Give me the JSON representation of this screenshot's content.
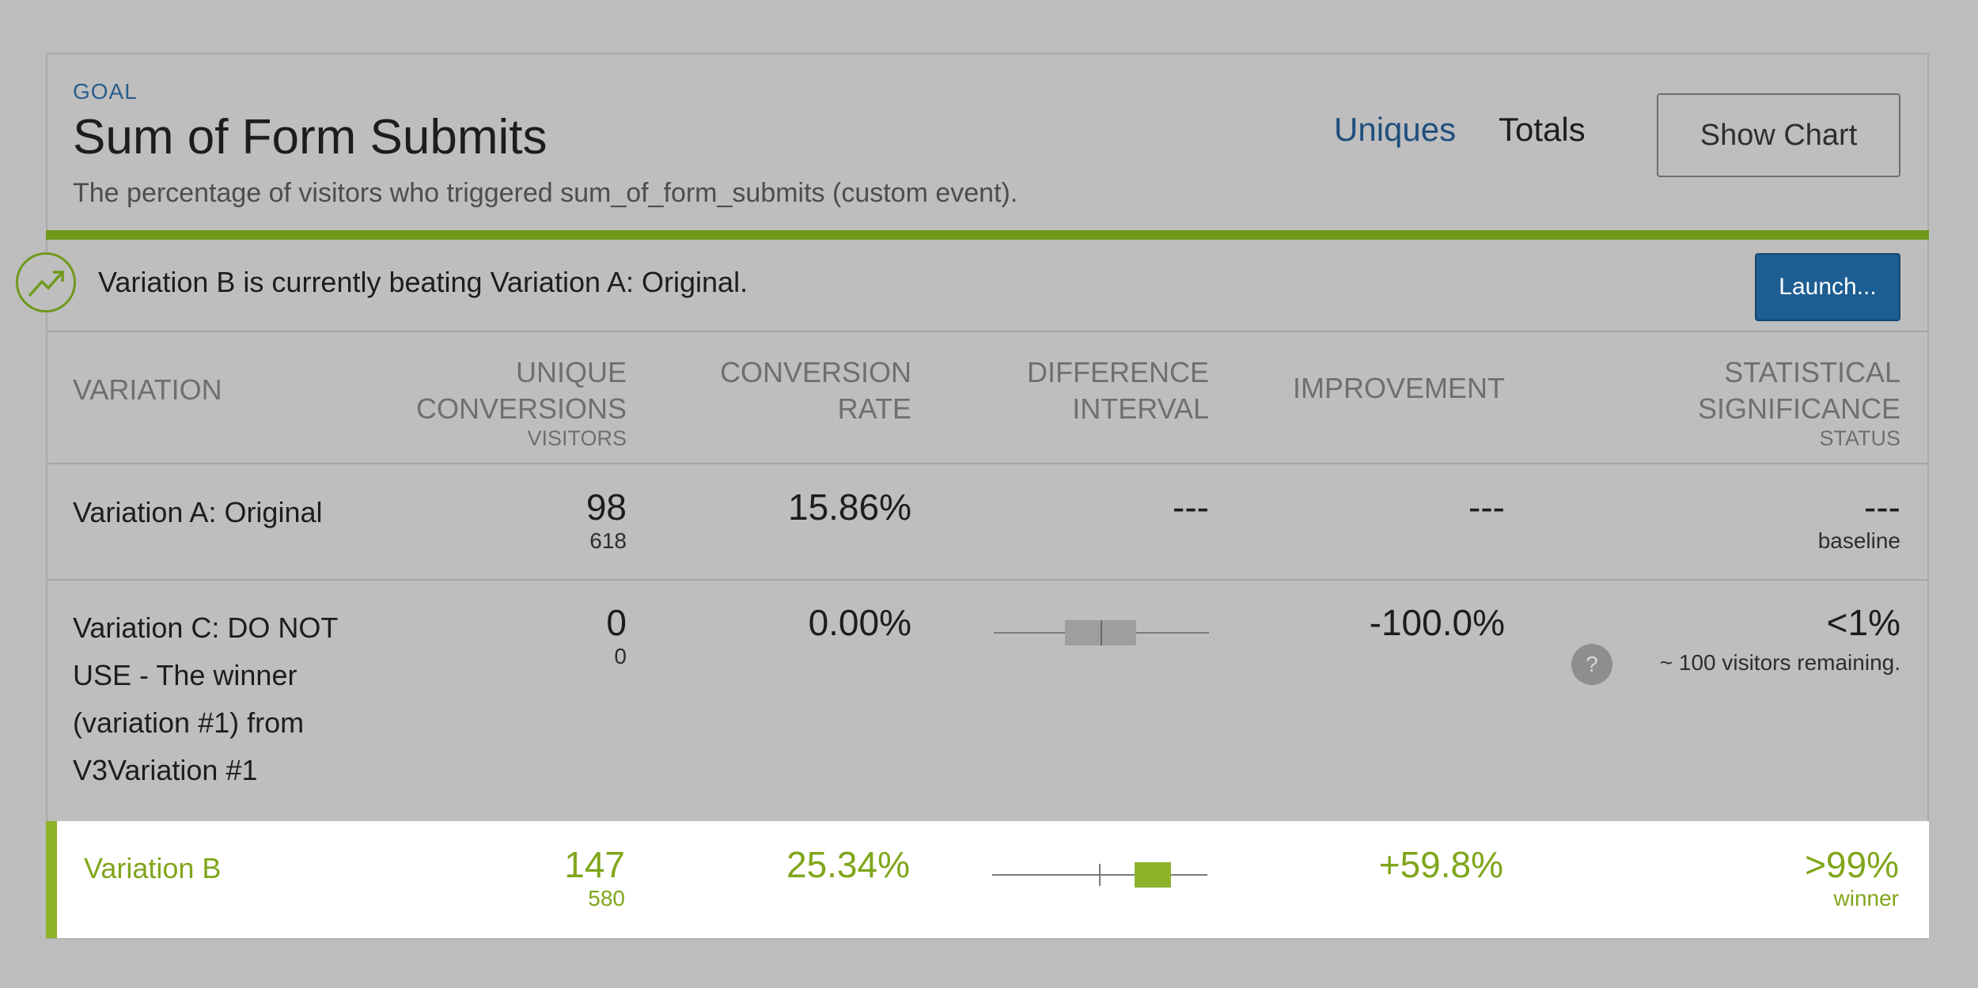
{
  "goal": {
    "label": "GOAL",
    "title": "Sum of Form Submits",
    "description": "The percentage of visitors who triggered sum_of_form_submits (custom event)."
  },
  "tabs": {
    "uniques": "Uniques",
    "totals": "Totals"
  },
  "show_chart_label": "Show Chart",
  "banner": {
    "icon": "trend-up-icon",
    "message": "Variation B is currently beating Variation A: Original.",
    "launch_label": "Launch..."
  },
  "columns": {
    "variation": "VARIATION",
    "unique_conversions": "UNIQUE CONVERSIONS",
    "visitors": "VISITORS",
    "conversion_rate": "CONVERSION RATE",
    "difference_interval": "DIFFERENCE INTERVAL",
    "improvement": "IMPROVEMENT",
    "statistical_significance": "STATISTICAL SIGNIFICANCE",
    "status": "STATUS"
  },
  "rows": [
    {
      "name": "Variation A: Original",
      "conversions": "98",
      "visitors": "618",
      "rate": "15.86%",
      "interval": "---",
      "improvement": "---",
      "significance": "---",
      "status": "baseline"
    },
    {
      "name_lines": [
        "Variation C: DO NOT",
        "USE - The winner",
        "(variation #1) from",
        "V3Variation #1"
      ],
      "conversions": "0",
      "visitors": "0",
      "rate": "0.00%",
      "interval_range": [
        -100,
        -50
      ],
      "improvement": "-100.0%",
      "significance": "<1%",
      "status": "~ 100 visitors remaining.",
      "help_icon": "?"
    },
    {
      "name": "Variation B",
      "conversions": "147",
      "visitors": "580",
      "rate": "25.34%",
      "interval_range": [
        30,
        90
      ],
      "improvement": "+59.8%",
      "significance": ">99%",
      "status": "winner"
    }
  ],
  "colors": {
    "winner_green": "#7fa61a",
    "accent_green": "#6e9a1c",
    "launch_blue": "#1d5d92",
    "link_blue": "#1f4f7d"
  }
}
